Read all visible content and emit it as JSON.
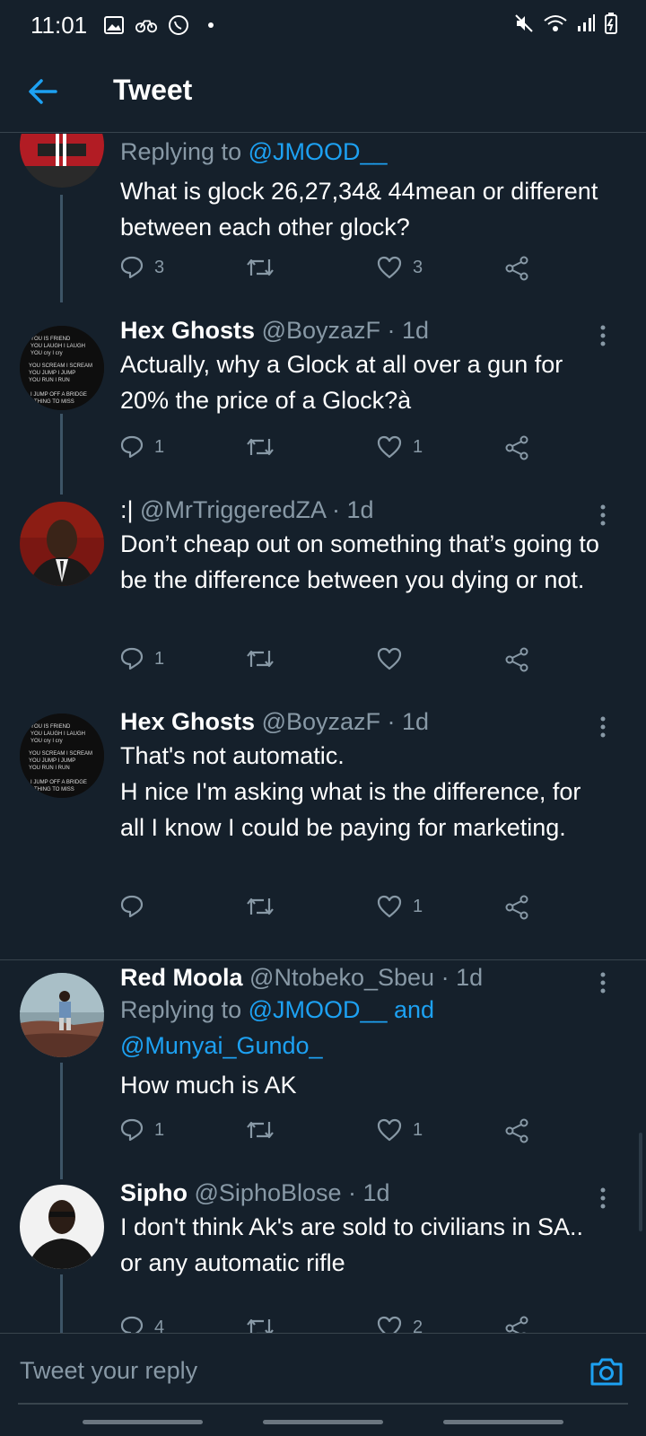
{
  "status_bar": {
    "time": "11:01"
  },
  "header": {
    "title": "Tweet"
  },
  "tweets": [
    {
      "reply_prefix": "Replying to ",
      "reply_mention": "@JMOOD__",
      "body": "What is glock 26,27,34& 44mean or different between each other glock?",
      "counts": {
        "replies": "3",
        "retweets": "",
        "likes": "3"
      }
    },
    {
      "display_name": "Hex Ghosts",
      "handle": "@BoyzazF",
      "time": " · 1d",
      "body": "Actually, why a Glock at all over a gun for 20% the price of a Glock?à",
      "counts": {
        "replies": "1",
        "retweets": "",
        "likes": "1"
      }
    },
    {
      "display_name": ":|",
      "handle": "@MrTriggeredZA",
      "time": " · 1d",
      "body": "Don’t cheap out on something that’s going to be the difference between you dying or not.",
      "counts": {
        "replies": "1",
        "retweets": "",
        "likes": ""
      }
    },
    {
      "display_name": "Hex Ghosts",
      "handle": "@BoyzazF",
      "time": " · 1d",
      "body_lines": [
        "That's not automatic.",
        "H nice I'm asking what is the difference, for all I know I could be paying for marketing."
      ],
      "counts": {
        "replies": "",
        "retweets": "",
        "likes": "1"
      }
    },
    {
      "display_name": "Red Moola",
      "handle": "@Ntobeko_Sbeu",
      "time": " · 1d",
      "reply_prefix": "Replying to ",
      "reply_mention": "@JMOOD__ and @Munyai_Gundo_",
      "body": "How much is AK",
      "counts": {
        "replies": "1",
        "retweets": "",
        "likes": "1"
      }
    },
    {
      "display_name": "Sipho",
      "handle": "@SiphoBlose",
      "time": " · 1d",
      "body": "I don't think Ak's are sold to civilians in SA.. or any automatic rifle",
      "counts": {
        "replies": "4",
        "retweets": "",
        "likes": "2"
      }
    }
  ],
  "meme_avatar_text": [
    "YOU IS FRIEND",
    "YOU LAUGH I LAUGH",
    "YOU cry I cry",
    "YOU SCREAM I SCREAM",
    "YOU JUMP I JUMP",
    "YOU RUN I RUN",
    "I JUMP OFF A BRIDGE",
    "THING TO MISS"
  ],
  "reply_bar": {
    "placeholder": "Tweet your reply"
  },
  "colors": {
    "background": "#15202b",
    "accent": "#1da1f2",
    "muted": "#8899a6",
    "border": "#38444d"
  },
  "icons": [
    "back-arrow-icon",
    "more-icon",
    "reply-icon",
    "retweet-icon",
    "like-icon",
    "share-icon",
    "camera-icon"
  ]
}
